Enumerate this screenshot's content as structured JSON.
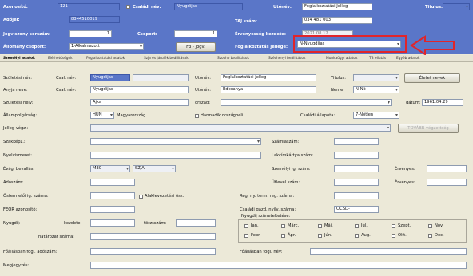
{
  "header": {
    "azonosito_label": "Azonosító:",
    "azonosito_value": "121",
    "csaladi_nev_label": "Családi név:",
    "csaladi_nev_value": "Nyugdíjas",
    "utonev_label": "Utónév:",
    "utonev_value": "Foglalkoztatási Jelleg",
    "titulus_label": "Titulus:",
    "adojel_label": "Adójel:",
    "adojel_value": "8344510019",
    "taj_label": "TAJ szám:",
    "taj_value": "034 481 003",
    "jogviszony_label": "Jogviszony sorszám:",
    "jogviszony_value": "1",
    "csoport_label": "Csoport:",
    "csoport_value": "1",
    "ervenyesseg_label": "Érvényesség kezdete:",
    "ervenyesseg_value": "2021.08.12.",
    "allomany_label": "Állomány csoport:",
    "allomany_value": "1-Alkalmazott",
    "f3_button": "F3 - Jogv.",
    "foglalkoztatas_label": "Foglalkoztatás jellege:",
    "foglalkoztatas_value": "N-Nyugdíjas"
  },
  "tabs": [
    "Személyi adatok",
    "Elérhetőségek",
    "Foglalkoztatási adatok",
    "Szja és járulék beállítások",
    "Szocho beállítások",
    "Széchényi beállítások",
    "Munkaügyi adatok",
    "TB ellátás",
    "Egyéb adatok"
  ],
  "form": {
    "szuletesi_nev_label": "Születési név:",
    "csal_nev_label": "Csal. név:",
    "szul_csal_nev_value": "Nyugdíjas",
    "utonev_label": "Utónév:",
    "szul_utonev_value": "Foglalkoztatási Jelleg",
    "titulus_label": "Titulus:",
    "eletet_button": "Életet nevek",
    "anyja_neve_label": "Anyja neve:",
    "anyja_csal_nev_value": "Nyugdíjas",
    "anyja_utonev_value": "Édesanya",
    "neme_label": "Neme:",
    "neme_value": "N-Nő",
    "szuletesi_hely_label": "Születési hely:",
    "szuletesi_hely_value": "Ajka",
    "orszag_label": "ország:",
    "datum_label": "dátum:",
    "datum_value": "1961.04.29",
    "allampolgarsag_label": "Állampolgárság:",
    "allampolgarsag_code": "HUN",
    "allampolgarsag_value": "Magyarország",
    "harmadik_orszag_label": "Harmadik országbeli",
    "csaladi_allapot_label": "Családi állapota:",
    "csaladi_allapot_value": "7-Nőtlen",
    "jelleg_label": "Jelleg végz.:",
    "tovabbi_button": "TOVÁBB végzettség",
    "szakkepz_label": "Szakképz.:",
    "szamlaszam_label": "Számlaszám:",
    "nyelvismeret_label": "Nyelvismeret:",
    "lakcimkartya_label": "Lakcímkártya szám:",
    "evagi_label": "Évági bevallás:",
    "evagi_value1": "M30",
    "evagi_value2": "SZJA",
    "szemelyi_ig_label": "Személyi ig. szám:",
    "ervenyes_label": "Érvényes:",
    "adoszam_label": "Adószám:",
    "utlevel_label": "Útlevél szám:",
    "ostermeloi_label": "Őstermelői ig. száma:",
    "alaklevezetesi_label": "Alaklevezetési ösz.",
    "reg_label": "Reg. ny. term. reg. száma:",
    "feor_label": "FEOR azonosító:",
    "csaladi_gazd_label": "Családi gazd. nyilv. száma:",
    "csaladi_gazd_value": "OCSD-",
    "nyugdij_label": "Nyugdíj:",
    "kezdete_label": "kezdete:",
    "torzsszam_label": "törzsszám:",
    "hatarozat_label": "határozat száma:",
    "szunetelteses_label": "Nyugdíj szüneteltetése:",
    "months": [
      "Jan.",
      "Márc.",
      "Máj.",
      "Júl.",
      "Szept.",
      "Nov.",
      "Febr.",
      "Ápr.",
      "Jún.",
      "Aug.",
      "Okt.",
      "Dec."
    ],
    "foallas_label": "Főállásban fogl. adószám:",
    "foallas_nev_label": "Főállásban fogl. név:",
    "megjegyzes_label": "Megjegyzés:"
  },
  "colors": {
    "accent_blue": "#5a76c8",
    "highlight_red": "#e0252b"
  },
  "annotation": {
    "arrow_icon": "arrow-left-icon"
  }
}
